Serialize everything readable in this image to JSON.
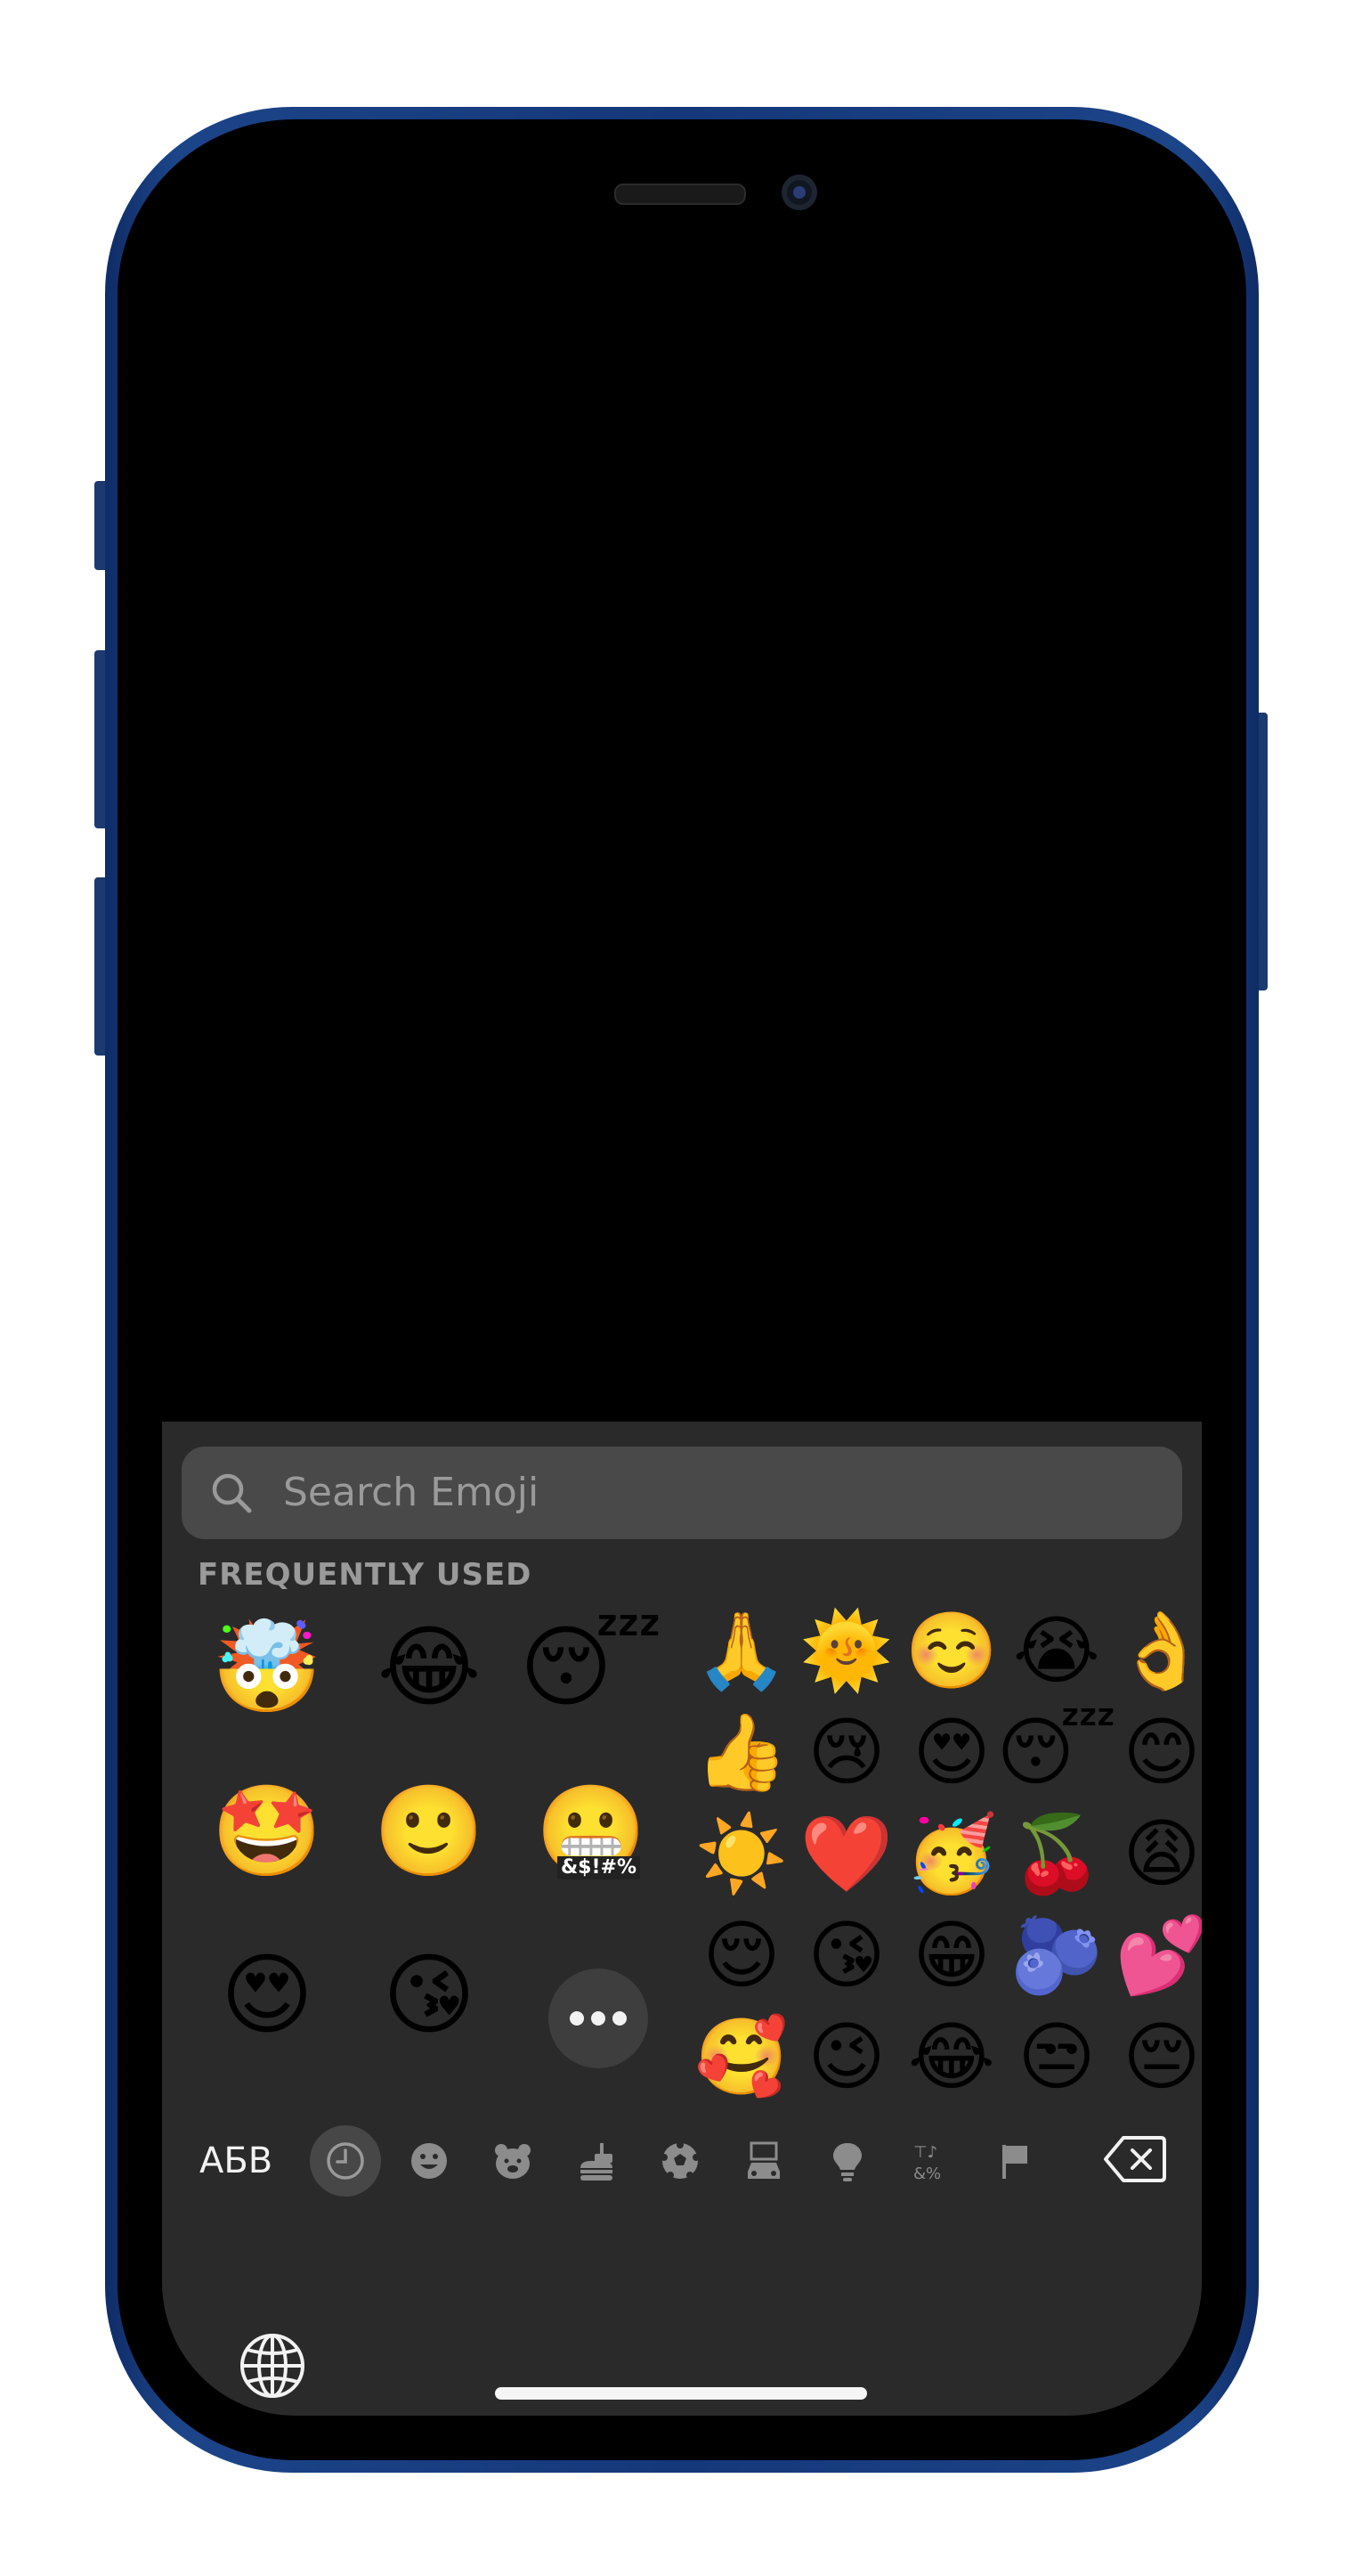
{
  "device": {
    "frame_color": "#1c4488",
    "screen_color": "#000000"
  },
  "keyboard": {
    "background": "#2a2a2a",
    "search": {
      "placeholder": "Search Emoji",
      "icon": "magnifying-glass-icon"
    },
    "section_title": "FREQUENTLY USED",
    "memoji_stickers": [
      {
        "name": "memoji-mind-blown",
        "glyph": "🤯",
        "caption": ""
      },
      {
        "name": "memoji-laughing-tears",
        "glyph": "😂",
        "caption": ""
      },
      {
        "name": "memoji-sleeping",
        "glyph": "😴",
        "caption": ""
      },
      {
        "name": "memoji-star-struck",
        "glyph": "🤩",
        "caption": ""
      },
      {
        "name": "memoji-thumbs-up",
        "glyph": "🙂",
        "caption": ""
      },
      {
        "name": "memoji-cursing",
        "glyph": "😬",
        "caption": "&$!#%"
      },
      {
        "name": "memoji-heart-eyes",
        "glyph": "😍",
        "caption": ""
      },
      {
        "name": "memoji-wink-heart",
        "glyph": "😘",
        "caption": ""
      }
    ],
    "more_button_icon": "ellipsis-icon",
    "emojis": [
      "🙏",
      "🌞",
      "☺️",
      "😭",
      "👌",
      "👍",
      "😢",
      "😍",
      "😴",
      "😊",
      "☀️",
      "❤️",
      "🥳",
      "🍒",
      "😩",
      "😌",
      "😘",
      "😁",
      "🫐",
      "💕",
      "🥰",
      "😉",
      "😂",
      "😒",
      "😔"
    ],
    "category_bar": {
      "abc_label": "АБВ",
      "categories": [
        {
          "name": "recents",
          "icon": "clock-icon",
          "active": true
        },
        {
          "name": "smileys",
          "icon": "smiley-icon",
          "active": false
        },
        {
          "name": "animals",
          "icon": "bear-icon",
          "active": false
        },
        {
          "name": "food",
          "icon": "burger-icon",
          "active": false
        },
        {
          "name": "activity",
          "icon": "soccer-ball-icon",
          "active": false
        },
        {
          "name": "travel",
          "icon": "building-car-icon",
          "active": false
        },
        {
          "name": "objects",
          "icon": "lightbulb-icon",
          "active": false
        },
        {
          "name": "symbols",
          "icon": "symbols-icon",
          "active": false
        },
        {
          "name": "flags",
          "icon": "flag-icon",
          "active": false
        }
      ],
      "delete_icon": "backspace-icon"
    },
    "globe_icon": "globe-icon"
  }
}
